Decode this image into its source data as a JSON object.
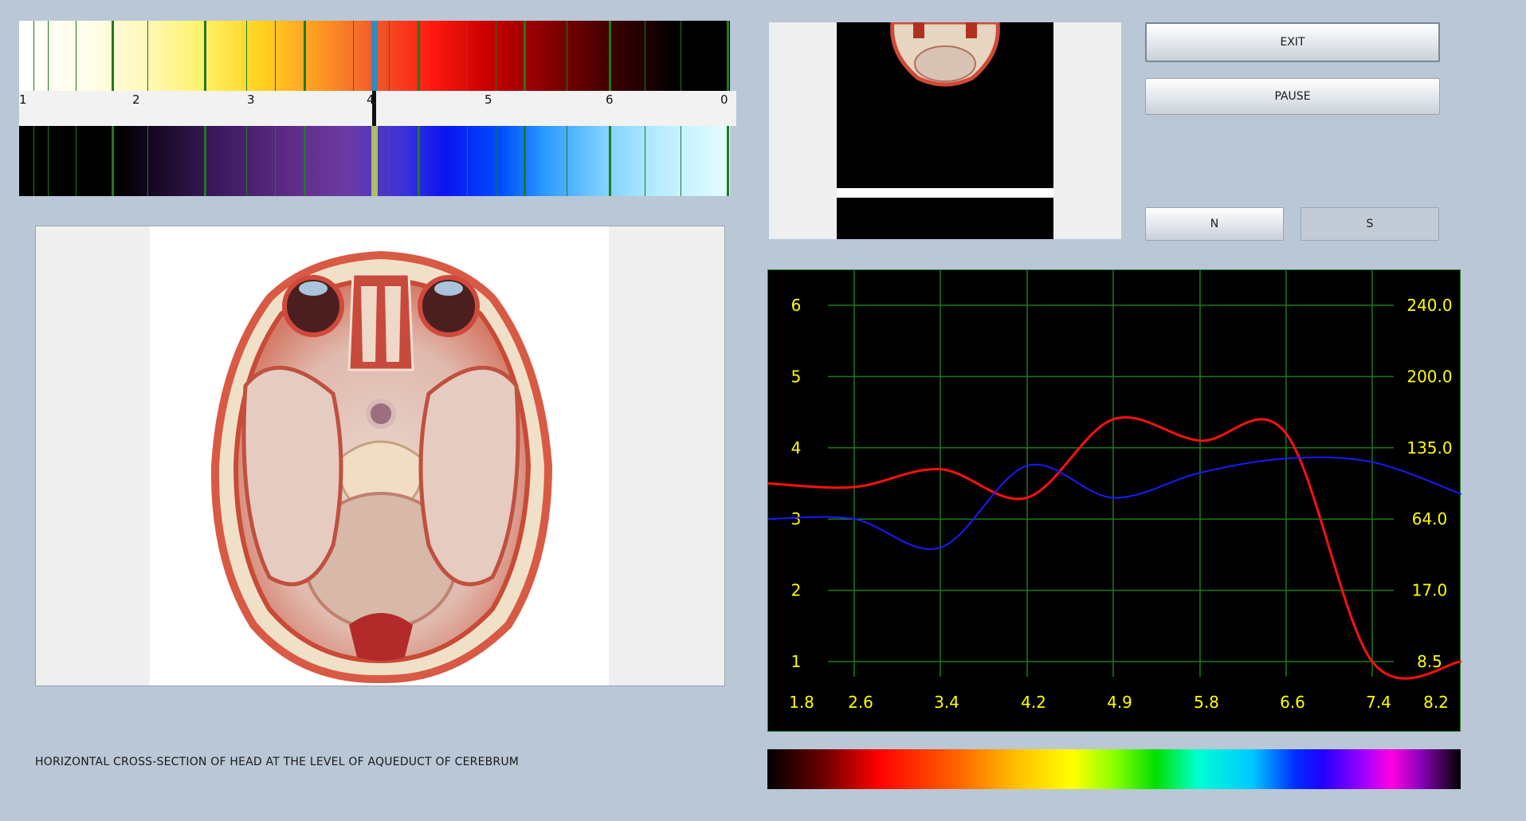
{
  "spectrum": {
    "scale_labels": [
      "1",
      "2",
      "3",
      "4",
      "5",
      "6",
      "0"
    ]
  },
  "caption": "HORIZONTAL CROSS-SECTION OF HEAD AT THE LEVEL OF AQUEDUCT OF CEREBRUM",
  "buttons": {
    "exit": "EXIT",
    "pause": "PAUSE",
    "n": "N",
    "s": "S"
  },
  "colors": {
    "background": "#b9c7d6",
    "chart_background": "#000000",
    "grid": "#1a7a1a",
    "label": "#ffff00",
    "red_series": "#ff1010",
    "blue_series": "#1a1aff"
  },
  "chart_data": {
    "type": "line",
    "x": [
      1.8,
      2.6,
      3.4,
      4.2,
      4.9,
      5.8,
      6.6,
      7.4,
      8.2
    ],
    "x_tick_labels": [
      "1.8",
      "2.6",
      "3.4",
      "4.2",
      "4.9",
      "5.8",
      "6.6",
      "7.4",
      "8.2"
    ],
    "y_left_ticks": [
      "1",
      "2",
      "3",
      "4",
      "5",
      "6"
    ],
    "y_right_ticks": [
      "8.5",
      "17.0",
      "64.0",
      "135.0",
      "200.0",
      "240.0"
    ],
    "ylim": [
      1,
      6
    ],
    "grid": true,
    "series": [
      {
        "color": "red",
        "values": [
          3.5,
          3.45,
          3.7,
          3.3,
          4.4,
          4.1,
          4.2,
          1.0,
          1.0
        ]
      },
      {
        "color": "blue",
        "values": [
          3.0,
          3.0,
          2.6,
          3.75,
          3.3,
          3.65,
          3.85,
          3.8,
          3.35
        ]
      }
    ]
  }
}
